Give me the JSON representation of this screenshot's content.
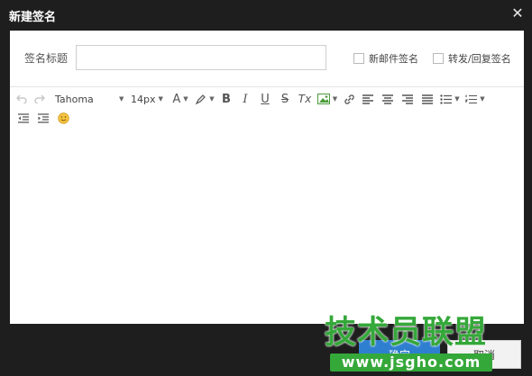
{
  "dialog": {
    "title": "新建签名",
    "close_glyph": "✕"
  },
  "form": {
    "title_label": "签名标题",
    "title_value": "",
    "title_placeholder": "",
    "checkbox_new_mail": "新邮件签名",
    "checkbox_reply": "转发/回复签名"
  },
  "toolbar": {
    "font_family": "Tahoma",
    "font_size": "14px",
    "icons": [
      "undo-icon",
      "redo-icon",
      "font-color-icon",
      "highlight-icon",
      "bold-icon",
      "italic-icon",
      "underline-icon",
      "strikethrough-icon",
      "clear-format-icon",
      "insert-image-icon",
      "link-icon",
      "align-left-icon",
      "align-center-icon",
      "align-right-icon",
      "align-justify-icon",
      "bullet-list-icon",
      "numbered-list-icon",
      "outdent-icon",
      "indent-icon",
      "emoji-icon"
    ],
    "bold": "B",
    "italic": "I",
    "underline": "U",
    "strike": "S",
    "clear": "Tx",
    "font_color": "A"
  },
  "buttons": {
    "ok": "确定",
    "cancel": "取消"
  },
  "watermark": {
    "text": "技术员联盟",
    "url": "www.jsgho.com"
  },
  "colors": {
    "chrome": "#1e1e1e",
    "accent": "#2f7fd0",
    "watermark_green": "#35a83a",
    "emoji_yellow": "#f5c542"
  }
}
